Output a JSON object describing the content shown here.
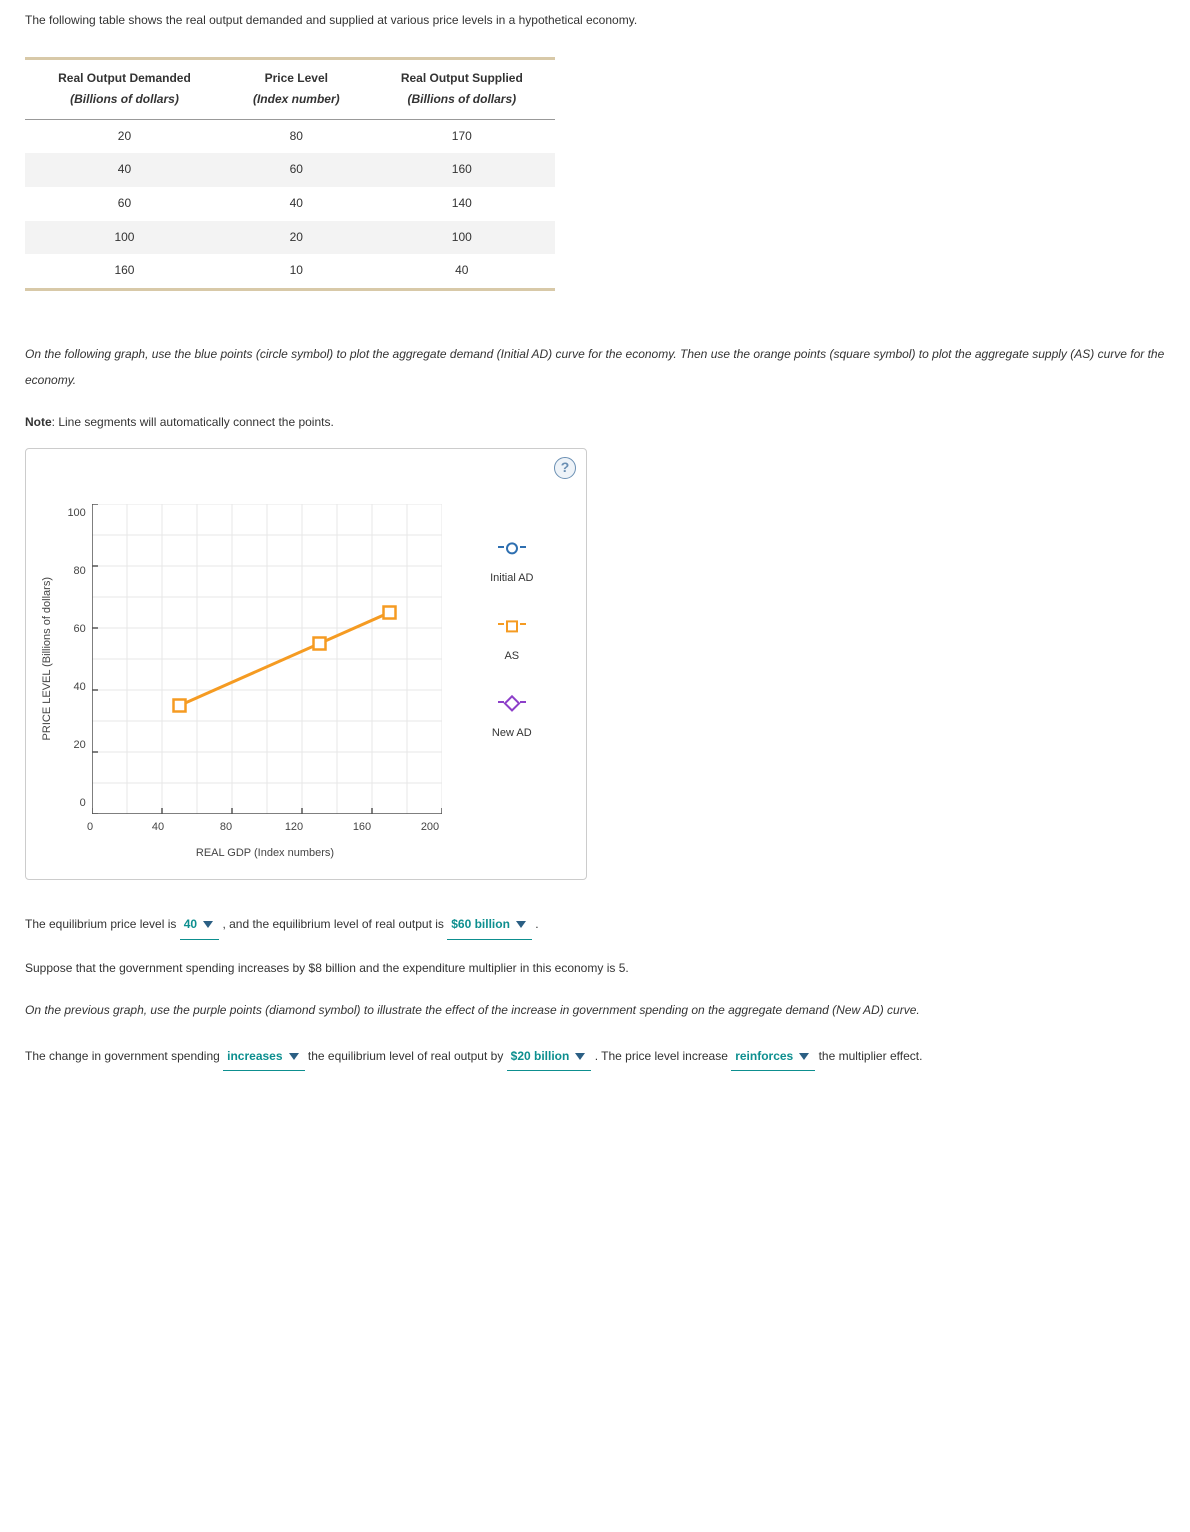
{
  "intro_text": "The following table shows the real output demanded and supplied at various price levels in a hypothetical economy.",
  "table": {
    "headers": [
      {
        "line1": "Real Output Demanded",
        "line2": "(Billions of dollars)"
      },
      {
        "line1": "Price Level",
        "line2": "(Index number)"
      },
      {
        "line1": "Real Output Supplied",
        "line2": "(Billions of dollars)"
      }
    ],
    "rows": [
      [
        "20",
        "80",
        "170"
      ],
      [
        "40",
        "60",
        "160"
      ],
      [
        "60",
        "40",
        "140"
      ],
      [
        "100",
        "20",
        "100"
      ],
      [
        "160",
        "10",
        "40"
      ]
    ]
  },
  "instruction1": "On the following graph, use the blue points (circle symbol) to plot the aggregate demand (Initial AD) curve for the economy. Then use the orange points (square symbol) to plot the aggregate supply (AS) curve for the economy.",
  "note_label": "Note",
  "note_text": ": Line segments will automatically connect the points.",
  "help_symbol": "?",
  "chart_data": {
    "type": "line",
    "xlabel": "REAL GDP (Index numbers)",
    "ylabel": "PRICE LEVEL (Billions of dollars)",
    "x_ticks": [
      "0",
      "40",
      "80",
      "120",
      "160",
      "200"
    ],
    "y_ticks": [
      "100",
      "80",
      "60",
      "40",
      "20",
      "0"
    ],
    "xlim": [
      0,
      200
    ],
    "ylim": [
      0,
      100
    ],
    "series": [
      {
        "name": "Initial AD",
        "symbol": "circle",
        "color": "#2e6fb0",
        "points": []
      },
      {
        "name": "AS",
        "symbol": "square",
        "color": "#f59b22",
        "points": [
          {
            "x": 50,
            "y": 35
          },
          {
            "x": 130,
            "y": 55
          },
          {
            "x": 170,
            "y": 65
          }
        ]
      },
      {
        "name": "New AD",
        "symbol": "diamond",
        "color": "#8d3fc9",
        "points": []
      }
    ]
  },
  "legend": {
    "items": [
      {
        "label": "Initial AD",
        "symbol": "circle",
        "color": "#2e6fb0"
      },
      {
        "label": "AS",
        "symbol": "square",
        "color": "#f59b22"
      },
      {
        "label": "New AD",
        "symbol": "diamond",
        "color": "#8d3fc9"
      }
    ]
  },
  "q1": {
    "pre1": "The equilibrium price level is ",
    "dd1": "40",
    "mid": " , and the equilibrium level of real output is ",
    "dd2": "$60 billion",
    "post": " ."
  },
  "para_gov": "Suppose that the government spending increases by $8 billion and the expenditure multiplier in this economy is 5.",
  "instruction2": "On the previous graph, use the purple points (diamond symbol) to illustrate the effect of the increase in government spending on the aggregate demand (New AD) curve.",
  "q2": {
    "pre1": "The change in government spending ",
    "dd1": "increases",
    "mid1": " the equilibrium level of real output by ",
    "dd2": "$20 billion",
    "mid2": " . The price level increase ",
    "dd3": "reinforces",
    "post": " the multiplier effect."
  }
}
